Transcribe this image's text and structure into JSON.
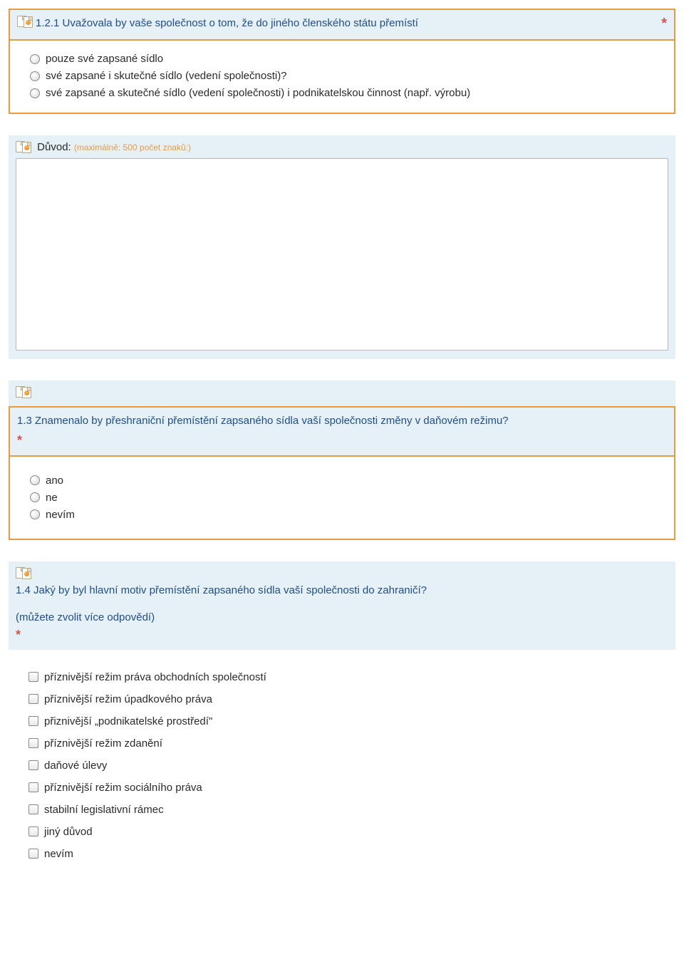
{
  "q1": {
    "title": "1.2.1 Uvažovala by vaše společnost o tom, že do jiného členského státu přemístí",
    "options": {
      "a": "pouze své zapsané sídlo",
      "b": "své zapsané i skutečné sídlo (vedení společnosti)?",
      "c": "své zapsané a skutečné sídlo (vedení společnosti) i podnikatelskou činnost (např. výrobu)"
    }
  },
  "reason": {
    "label": "Důvod:",
    "hint": "(maximálně: 500 počet znaků:)"
  },
  "q3": {
    "title": "1.3 Znamenalo by přeshraniční přemístění zapsaného sídla vaší společnosti změny v daňovém režimu?",
    "options": {
      "a": "ano",
      "b": "ne",
      "c": "nevím"
    }
  },
  "q4": {
    "title": "1.4 Jaký by byl hlavní motiv přemístění zapsaného sídla vaší společnosti do zahraničí?",
    "subtext": "(můžete zvolit více odpovědí)",
    "options": {
      "a": "příznivější režim práva obchodních společností",
      "b": "příznivější režim úpadkového práva",
      "c": "přiznivější „podnikatelské prostředí\"",
      "d": "příznivější režim zdanění",
      "e": "daňové úlevy",
      "f": "příznivější režim sociálního práva",
      "g": "stabilní legislativní rámec",
      "h": "jiný důvod",
      "i": "nevím"
    }
  }
}
